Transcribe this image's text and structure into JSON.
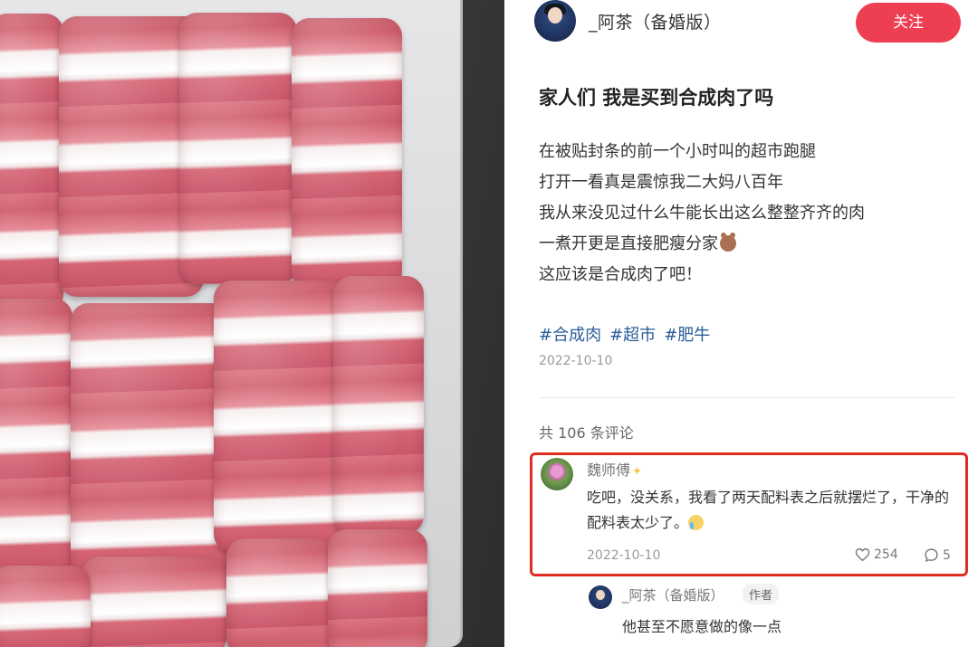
{
  "author": {
    "name": "_阿茶（备婚版）",
    "follow_label": "关注"
  },
  "post": {
    "title": "家人们 我是买到合成肉了吗",
    "lines": [
      "在被贴封条的前一个小时叫的超市跑腿",
      "打开一看真是震惊我二大妈八百年",
      "我从来没见过什么牛能长出这么整整齐齐的肉",
      "一煮开更是直接肥瘦分家",
      "这应该是合成肉了吧！"
    ],
    "tags": [
      "#合成肉",
      "#超市",
      "#肥牛"
    ],
    "date": "2022-10-10"
  },
  "comments_header": "共 106 条评论",
  "comment": {
    "user": "魏师傅",
    "text": "吃吧，没关系，我看了两天配料表之后就摆烂了，干净的配料表太少了。",
    "date": "2022-10-10",
    "likes": "254",
    "replies": "5"
  },
  "reply": {
    "user": "_阿茶（备婚版）",
    "badge": "作者",
    "text": "他甚至不愿意做的像一点"
  },
  "colors": {
    "accent": "#ee3e52",
    "tag": "#2b5c9a",
    "highlight": "#e02c21"
  },
  "icons": [
    "heart-icon",
    "comment-bubble-icon"
  ]
}
